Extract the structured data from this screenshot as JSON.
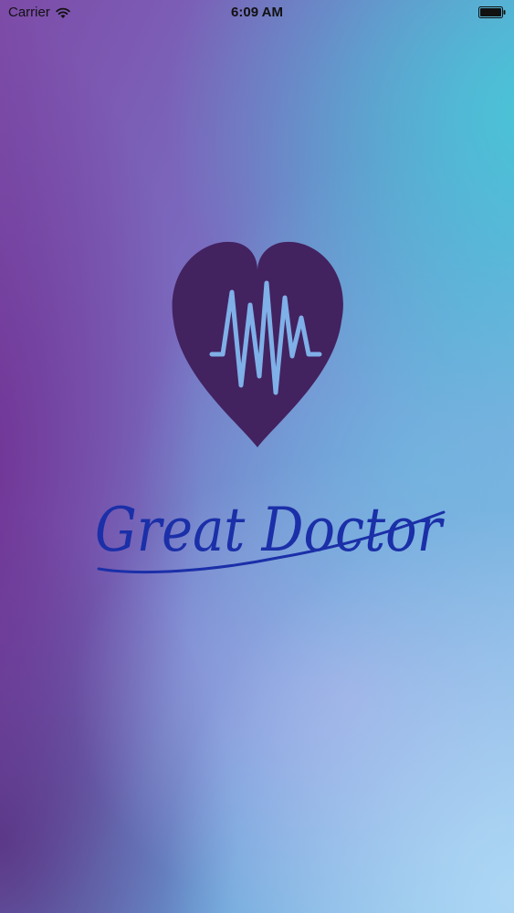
{
  "status_bar": {
    "carrier": "Carrier",
    "time": "6:09 AM",
    "icons": [
      "wifi-icon",
      "battery-icon"
    ]
  },
  "splash": {
    "logo_icon": "heart-pulse-icon",
    "brand_text": "Great Doctor",
    "colors": {
      "heart_fill": "#432260",
      "pulse_line": "#7fb0e8",
      "wordmark": "#1b2fa8"
    }
  }
}
